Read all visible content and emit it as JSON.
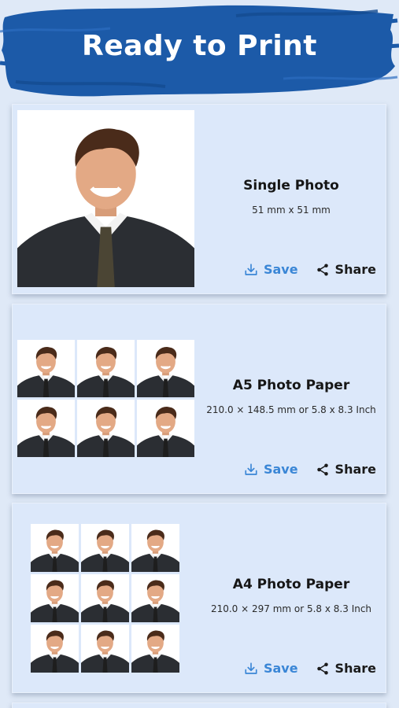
{
  "header": {
    "title": "Ready to Print",
    "brush_color": "#1c5aa8"
  },
  "cards": [
    {
      "title": "Single Photo",
      "size": "51 mm x 51 mm",
      "save_label": "Save",
      "share_label": "Share",
      "layout": "1x1"
    },
    {
      "title": "A5 Photo Paper",
      "size": "210.0 × 148.5 mm or 5.8 x 8.3 Inch",
      "save_label": "Save",
      "share_label": "Share",
      "layout": "3x2"
    },
    {
      "title": "A4 Photo Paper",
      "size": "210.0 × 297 mm or 5.8 x 8.3 Inch",
      "save_label": "Save",
      "share_label": "Share",
      "layout": "3x3"
    }
  ],
  "icons": {
    "save": "download-icon",
    "share": "share-icon"
  },
  "colors": {
    "save": "#3a86d6",
    "share": "#1b1b1b",
    "card_bg": "#dce8fa",
    "page_bg": "#dfe9f7"
  }
}
